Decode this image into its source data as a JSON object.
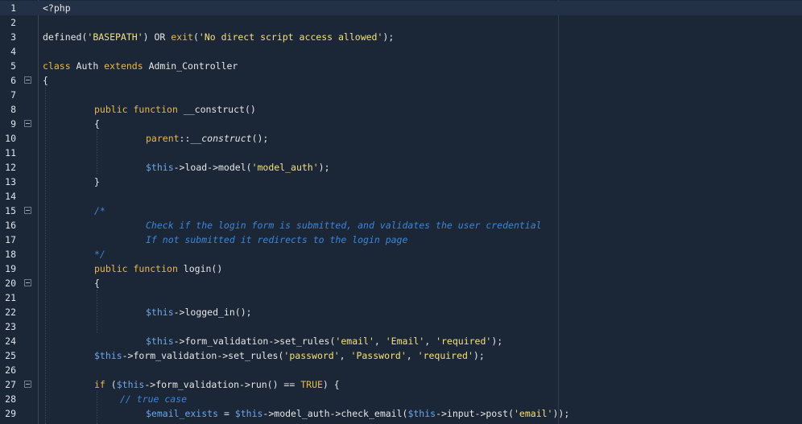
{
  "editor": {
    "colors": {
      "background": "#1b2637",
      "current_line": "#233147",
      "line_number": "#dfe3ea",
      "keyword": "#e8b94f",
      "string": "#f3e07d",
      "variable": "#6fa6e8",
      "comment": "#3d86d6",
      "text": "#e6e6e6"
    },
    "current_line": 1,
    "fold_icon": "fold-minus-icon",
    "lines": [
      {
        "n": "1",
        "fold": false,
        "indent": 0,
        "tokens": [
          {
            "t": "plain",
            "v": "<?php"
          }
        ]
      },
      {
        "n": "2",
        "fold": false,
        "indent": 0,
        "tokens": []
      },
      {
        "n": "3",
        "fold": false,
        "indent": 0,
        "tokens": [
          {
            "t": "plain",
            "v": "defined("
          },
          {
            "t": "str",
            "v": "'BASEPATH'"
          },
          {
            "t": "plain",
            "v": ") OR "
          },
          {
            "t": "kw",
            "v": "exit"
          },
          {
            "t": "plain",
            "v": "("
          },
          {
            "t": "str",
            "v": "'No direct script access allowed'"
          },
          {
            "t": "plain",
            "v": ");"
          }
        ]
      },
      {
        "n": "4",
        "fold": false,
        "indent": 0,
        "tokens": []
      },
      {
        "n": "5",
        "fold": false,
        "indent": 0,
        "tokens": [
          {
            "t": "kw",
            "v": "class"
          },
          {
            "t": "plain",
            "v": " Auth "
          },
          {
            "t": "kw",
            "v": "extends"
          },
          {
            "t": "plain",
            "v": " Admin_Controller"
          }
        ]
      },
      {
        "n": "6",
        "fold": true,
        "indent": 0,
        "tokens": [
          {
            "t": "plain",
            "v": "{"
          }
        ]
      },
      {
        "n": "7",
        "fold": false,
        "indent": 0,
        "tokens": []
      },
      {
        "n": "8",
        "fold": false,
        "indent": 8,
        "tokens": [
          {
            "t": "kw",
            "v": "public"
          },
          {
            "t": "plain",
            "v": " "
          },
          {
            "t": "kw",
            "v": "function"
          },
          {
            "t": "plain",
            "v": " __construct()"
          }
        ]
      },
      {
        "n": "9",
        "fold": true,
        "indent": 8,
        "tokens": [
          {
            "t": "plain",
            "v": "{"
          }
        ]
      },
      {
        "n": "10",
        "fold": false,
        "indent": 16,
        "tokens": [
          {
            "t": "kw",
            "v": "parent"
          },
          {
            "t": "plain",
            "v": "::"
          },
          {
            "t": "italic",
            "v": "__construct"
          },
          {
            "t": "plain",
            "v": "();"
          }
        ]
      },
      {
        "n": "11",
        "fold": false,
        "indent": 0,
        "tokens": []
      },
      {
        "n": "12",
        "fold": false,
        "indent": 16,
        "tokens": [
          {
            "t": "var",
            "v": "$this"
          },
          {
            "t": "plain",
            "v": "->load->model("
          },
          {
            "t": "str",
            "v": "'model_auth'"
          },
          {
            "t": "plain",
            "v": ");"
          }
        ]
      },
      {
        "n": "13",
        "fold": false,
        "indent": 8,
        "tokens": [
          {
            "t": "plain",
            "v": "}"
          }
        ]
      },
      {
        "n": "14",
        "fold": false,
        "indent": 0,
        "tokens": []
      },
      {
        "n": "15",
        "fold": true,
        "indent": 8,
        "tokens": [
          {
            "t": "cmt",
            "v": "/*"
          }
        ]
      },
      {
        "n": "16",
        "fold": false,
        "indent": 16,
        "tokens": [
          {
            "t": "cmt",
            "v": "Check if the login form is submitted, and validates the user credential"
          }
        ]
      },
      {
        "n": "17",
        "fold": false,
        "indent": 16,
        "tokens": [
          {
            "t": "cmt",
            "v": "If not submitted it redirects to the login page"
          }
        ]
      },
      {
        "n": "18",
        "fold": false,
        "indent": 8,
        "tokens": [
          {
            "t": "cmt",
            "v": "*/"
          }
        ]
      },
      {
        "n": "19",
        "fold": false,
        "indent": 8,
        "tokens": [
          {
            "t": "kw",
            "v": "public"
          },
          {
            "t": "plain",
            "v": " "
          },
          {
            "t": "kw",
            "v": "function"
          },
          {
            "t": "plain",
            "v": " login()"
          }
        ]
      },
      {
        "n": "20",
        "fold": true,
        "indent": 8,
        "tokens": [
          {
            "t": "plain",
            "v": "{"
          }
        ]
      },
      {
        "n": "21",
        "fold": false,
        "indent": 0,
        "tokens": []
      },
      {
        "n": "22",
        "fold": false,
        "indent": 16,
        "tokens": [
          {
            "t": "var",
            "v": "$this"
          },
          {
            "t": "plain",
            "v": "->logged_in();"
          }
        ]
      },
      {
        "n": "23",
        "fold": false,
        "indent": 0,
        "tokens": []
      },
      {
        "n": "24",
        "fold": false,
        "indent": 16,
        "tokens": [
          {
            "t": "var",
            "v": "$this"
          },
          {
            "t": "plain",
            "v": "->form_validation->set_rules("
          },
          {
            "t": "str",
            "v": "'email'"
          },
          {
            "t": "plain",
            "v": ", "
          },
          {
            "t": "str",
            "v": "'Email'"
          },
          {
            "t": "plain",
            "v": ", "
          },
          {
            "t": "str",
            "v": "'required'"
          },
          {
            "t": "plain",
            "v": ");"
          }
        ]
      },
      {
        "n": "25",
        "fold": false,
        "indent": 8,
        "tokens": [
          {
            "t": "var",
            "v": "$this"
          },
          {
            "t": "plain",
            "v": "->form_validation->set_rules("
          },
          {
            "t": "str",
            "v": "'password'"
          },
          {
            "t": "plain",
            "v": ", "
          },
          {
            "t": "str",
            "v": "'Password'"
          },
          {
            "t": "plain",
            "v": ", "
          },
          {
            "t": "str",
            "v": "'required'"
          },
          {
            "t": "plain",
            "v": ");"
          }
        ]
      },
      {
        "n": "26",
        "fold": false,
        "indent": 0,
        "tokens": []
      },
      {
        "n": "27",
        "fold": true,
        "indent": 8,
        "tokens": [
          {
            "t": "kw",
            "v": "if"
          },
          {
            "t": "plain",
            "v": " ("
          },
          {
            "t": "var",
            "v": "$this"
          },
          {
            "t": "plain",
            "v": "->form_validation->run() == "
          },
          {
            "t": "kw",
            "v": "TRUE"
          },
          {
            "t": "plain",
            "v": ") {"
          }
        ]
      },
      {
        "n": "28",
        "fold": false,
        "indent": 12,
        "tokens": [
          {
            "t": "cmt",
            "v": "// true case"
          }
        ]
      },
      {
        "n": "29",
        "fold": false,
        "indent": 16,
        "tokens": [
          {
            "t": "var",
            "v": "$email_exists"
          },
          {
            "t": "plain",
            "v": " = "
          },
          {
            "t": "var",
            "v": "$this"
          },
          {
            "t": "plain",
            "v": "->model_auth->check_email("
          },
          {
            "t": "var",
            "v": "$this"
          },
          {
            "t": "plain",
            "v": "->input->post("
          },
          {
            "t": "str",
            "v": "'email'"
          },
          {
            "t": "plain",
            "v": "));"
          }
        ]
      }
    ]
  }
}
